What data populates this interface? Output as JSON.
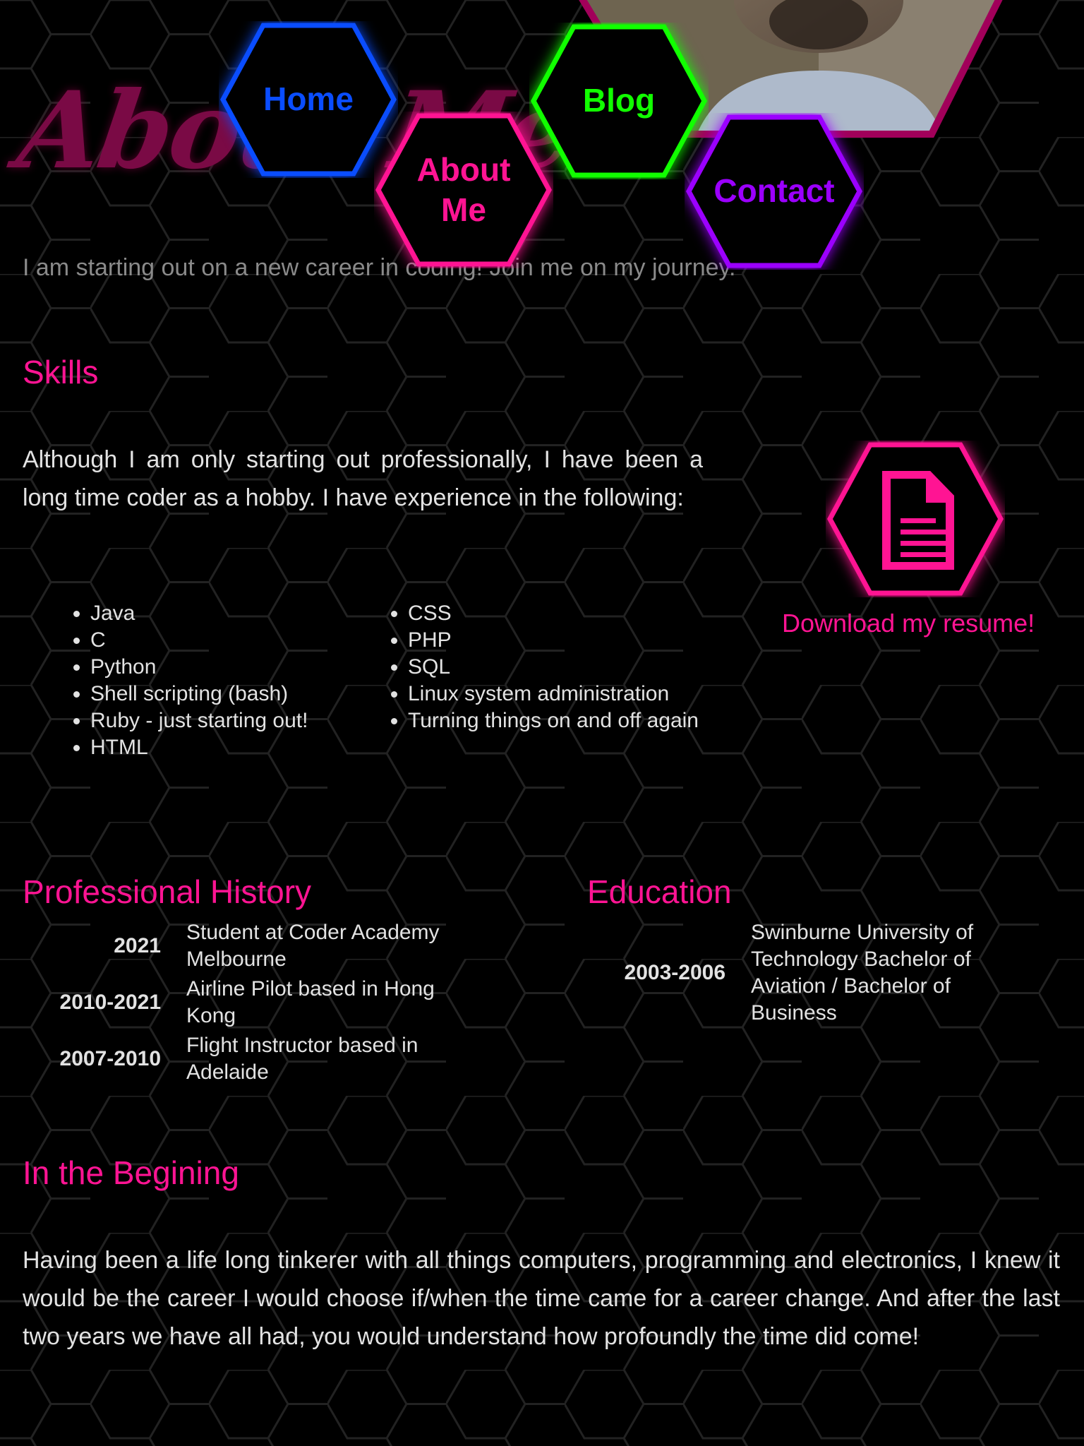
{
  "nav": [
    {
      "label": "Home",
      "color": "#0a4dff"
    },
    {
      "label": "About Me",
      "color": "#ff1493"
    },
    {
      "label": "Blog",
      "color": "#11ff00"
    },
    {
      "label": "Contact",
      "color": "#9b00ff"
    }
  ],
  "header": {
    "title": "About Me",
    "tagline": "I am starting out on a new career in coding! Join me on my journey."
  },
  "skills": {
    "heading": "Skills",
    "intro": "Although I am only starting out professionally, I have been a long time coder as a hobby. I have experience in the following:",
    "col1": [
      "Java",
      "C",
      "Python",
      "Shell scripting (bash)",
      "Ruby - just starting out!",
      "HTML"
    ],
    "col2": [
      "CSS",
      "PHP",
      "SQL",
      "Linux system administration",
      "Turning things on and off again"
    ],
    "resume_label": "Download my resume!",
    "resume_icon": "document-icon"
  },
  "history": {
    "heading": "Professional History",
    "rows": [
      {
        "year": "2021",
        "text": "Student at Coder Academy Melbourne"
      },
      {
        "year": "2010-2021",
        "text": "Airline Pilot based in Hong Kong"
      },
      {
        "year": "2007-2010",
        "text": "Flight Instructor based in Adelaide"
      }
    ]
  },
  "education": {
    "heading": "Education",
    "rows": [
      {
        "year": "2003-2006",
        "text": "Swinburne University of Technology Bachelor of Aviation / Bachelor of Business"
      }
    ]
  },
  "beginning": {
    "heading": "In the Begining",
    "text": "Having been a life long tinkerer with all things computers, programming and electronics, I knew it would be the career I would choose if/when the time came for a career change. And after the last two years we have all had, you would understand how profoundly the time did come!"
  },
  "colors": {
    "accent": "#ff1493",
    "background": "#000000"
  }
}
